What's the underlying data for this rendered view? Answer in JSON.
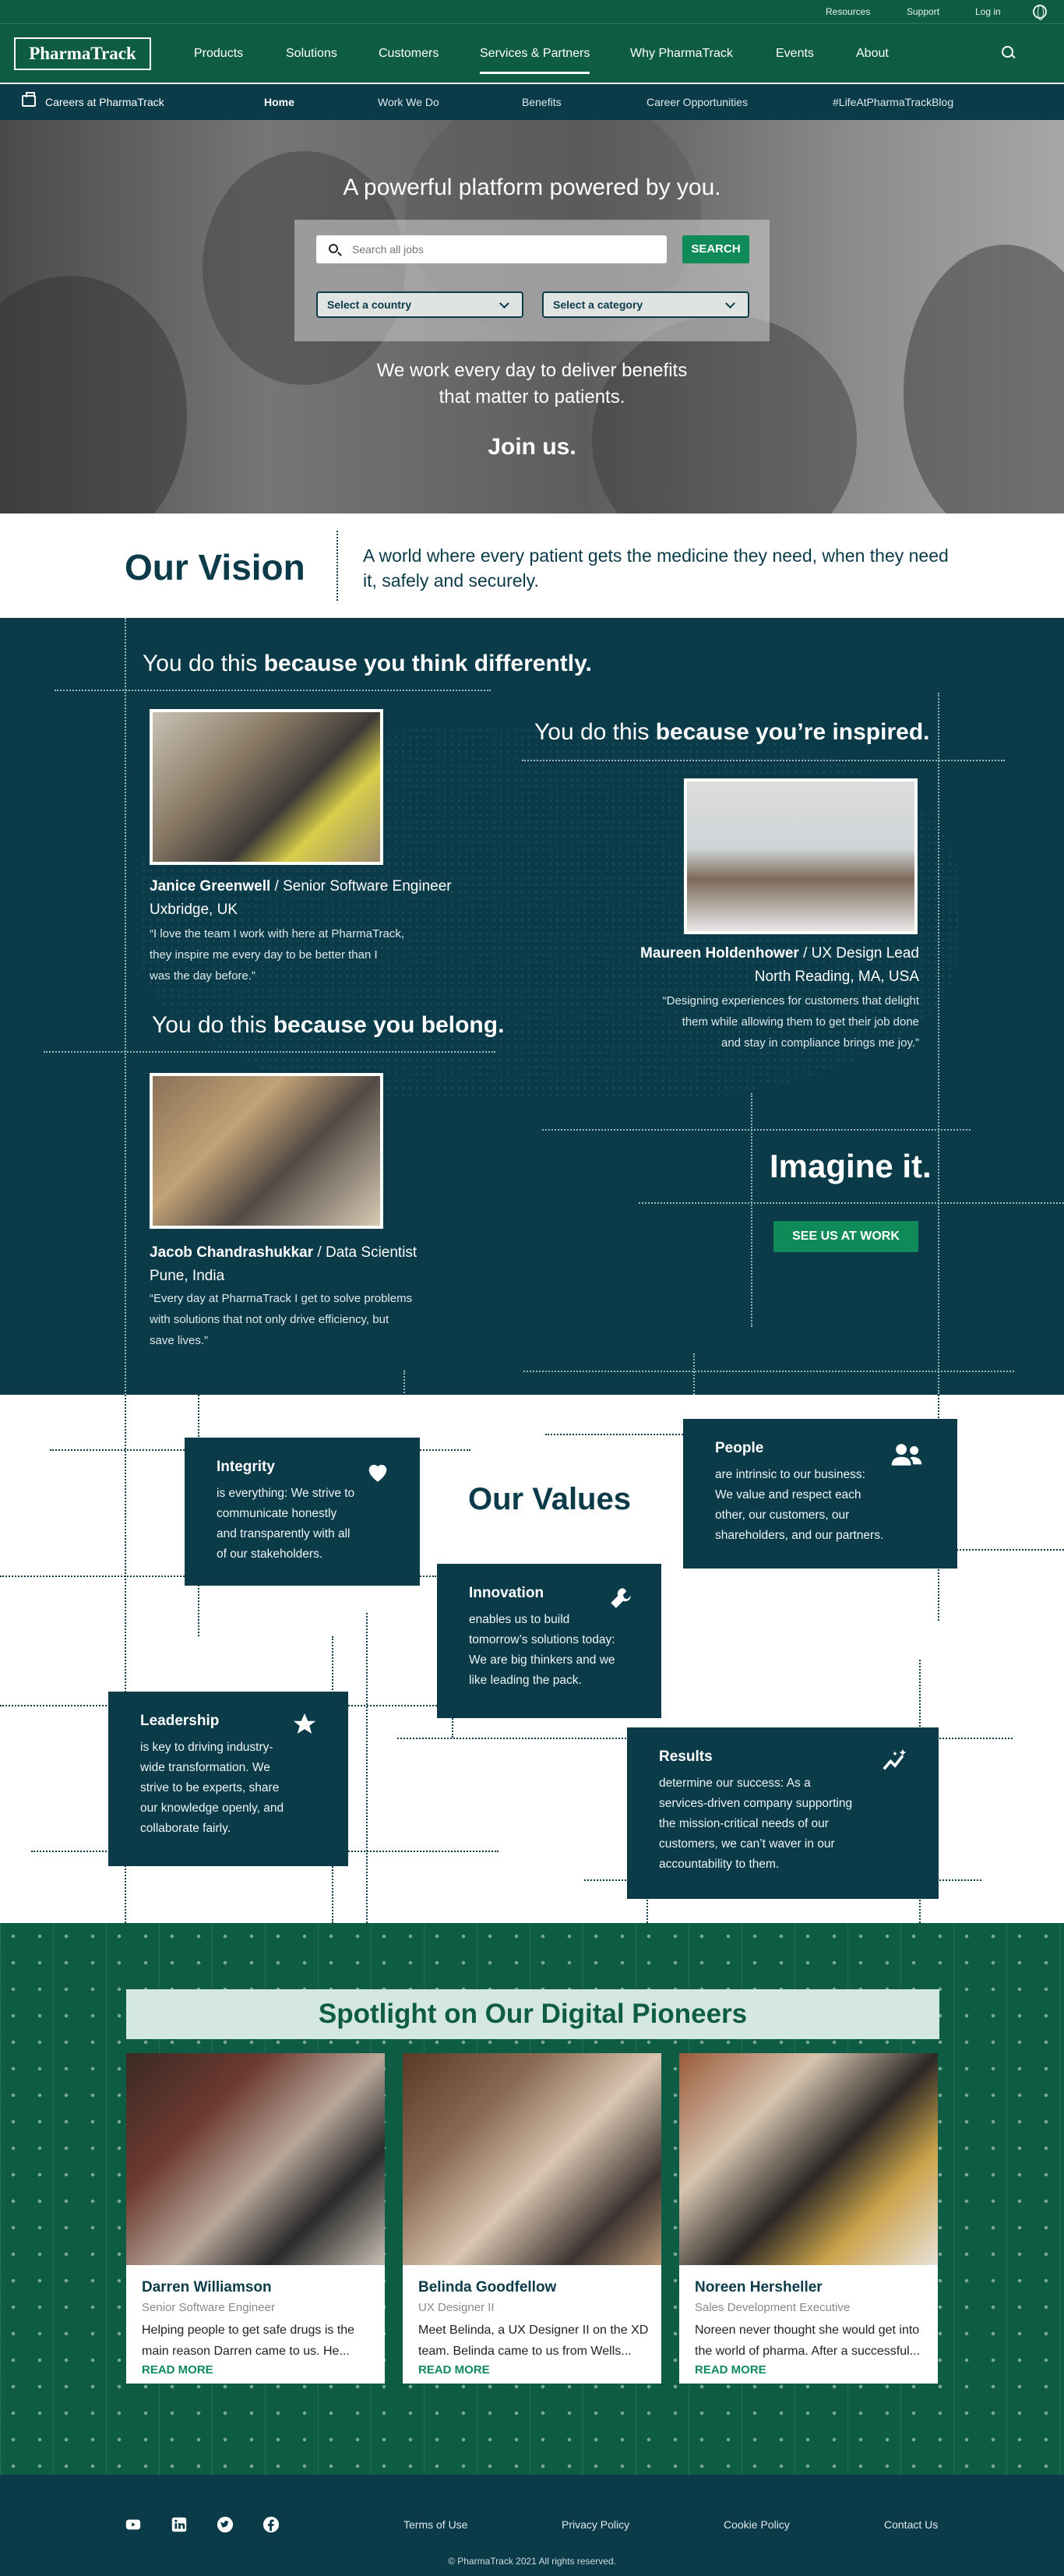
{
  "topbar": {
    "resources": "Resources",
    "support": "Support",
    "login": "Log in"
  },
  "nav": {
    "logo": "PharmaTrack",
    "items": [
      "Products",
      "Solutions",
      "Customers",
      "Services & Partners",
      "Why PharmaTrack",
      "Events",
      "About"
    ],
    "active": "Services & Partners"
  },
  "subnav": {
    "careers": "Careers at PharmaTrack",
    "items": [
      "Home",
      "Work We Do",
      "Benefits",
      "Career Opportunities",
      "#LifeAtPharmaTrackBlog"
    ]
  },
  "hero": {
    "title": "A powerful platform powered by you.",
    "search_placeholder": "Search all jobs",
    "search_button": "SEARCH",
    "country": "Select a country",
    "category": "Select a category",
    "tagline_1": "We work every day to deliver benefits",
    "tagline_2": "that matter to patients.",
    "join": "Join us."
  },
  "vision": {
    "title": "Our Vision",
    "text": "A world where every patient gets the medicine they need, when they need it, safely and securely."
  },
  "stories": {
    "h1_pre": "You do this ",
    "h1_bold": "because you think differently.",
    "h2_pre": "You do this ",
    "h2_bold": "because you’re inspired.",
    "h3_pre": "You do this ",
    "h3_bold": "because you belong.",
    "p1": {
      "name": "Janice Greenwell",
      "title": " / Senior Software Engineer",
      "location": "Uxbridge, UK",
      "quote_1": "“I love the team I work with here at PharmaTrack,",
      "quote_2": "they inspire me every day to be better than I",
      "quote_3": "was the day before.”"
    },
    "p2": {
      "name": "Maureen Holdenhower",
      "title": " / UX Design Lead",
      "location": "North Reading, MA, USA",
      "quote_1": "“Designing experiences for customers that delight",
      "quote_2": "them while allowing them to get their job done",
      "quote_3": "and stay in compliance brings me joy.”"
    },
    "p3": {
      "name": "Jacob Chandrashukkar",
      "title": " / Data Scientist",
      "location": "Pune, India",
      "quote_1": "“Every day at PharmaTrack I get to solve problems",
      "quote_2": "with solutions that not only drive efficiency, but",
      "quote_3": "save lives.”"
    },
    "imagine": "Imagine it.",
    "see_us": "SEE US AT WORK"
  },
  "values": {
    "title": "Our Values",
    "integrity": {
      "title": "Integrity",
      "l1": "is everything: We strive to",
      "l2": "communicate honestly",
      "l3": "and transparently with all",
      "l4": "of our stakeholders.",
      "icon": "heart-icon"
    },
    "people": {
      "title": "People",
      "l1": "are intrinsic to our business:",
      "l2": "We value and respect each",
      "l3": "other, our customers, our",
      "l4": "shareholders, and our partners.",
      "icon": "people-icon"
    },
    "innovation": {
      "title": "Innovation",
      "l1": "enables us to build",
      "l2": "tomorrow’s solutions today:",
      "l3": "We are big thinkers and we",
      "l4": "like leading the pack.",
      "icon": "wrench-icon"
    },
    "leadership": {
      "title": "Leadership",
      "l1": "is key to driving industry-",
      "l2": "wide transformation. We",
      "l3": "strive to be experts, share",
      "l4": "our knowledge openly, and",
      "l5": "collaborate fairly.",
      "icon": "star-icon"
    },
    "results": {
      "title": "Results",
      "l1": "determine our success: As a",
      "l2": "services-driven company supporting",
      "l3": "the mission-critical needs of our",
      "l4": "customers, we can’t waver in our",
      "l5": "accountability to them.",
      "icon": "chart-spark-icon"
    }
  },
  "spotlight": {
    "title": "Spotlight on Our Digital Pioneers",
    "cards": [
      {
        "name": "Darren Williamson",
        "role": "Senior Software Engineer",
        "desc": "Helping people to get safe drugs is the main reason Darren came to us. He...",
        "more": "READ MORE"
      },
      {
        "name": "Belinda Goodfellow",
        "role": "UX Designer II",
        "desc": "Meet Belinda, a UX Designer II on the XD team. Belinda came to us from Wells...",
        "more": "READ MORE"
      },
      {
        "name": "Noreen Hersheller",
        "role": "Sales Development Executive",
        "desc": "Noreen never thought she would get into the world of pharma. After a successful...",
        "more": "READ MORE"
      }
    ]
  },
  "footer": {
    "links": [
      "Terms of Use",
      "Privacy Policy",
      "Cookie Policy",
      "Contact Us"
    ],
    "copyright": "© PharmaTrack 2021 All rights reserved.",
    "social": [
      "youtube-icon",
      "linkedin-icon",
      "twitter-icon",
      "facebook-icon"
    ]
  }
}
